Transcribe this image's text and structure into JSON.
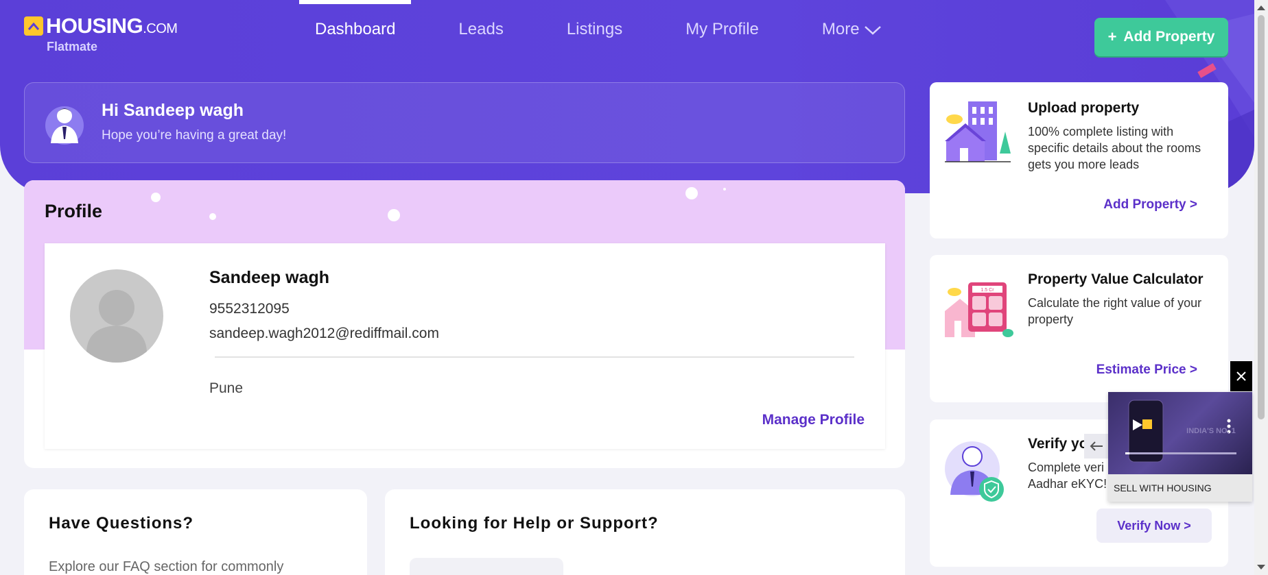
{
  "brand": {
    "name": "HOUSING",
    "suffix": ".COM",
    "sub": "Flatmate"
  },
  "nav": {
    "items": [
      {
        "label": "Dashboard"
      },
      {
        "label": "Leads"
      },
      {
        "label": "Listings"
      },
      {
        "label": "My Profile"
      },
      {
        "label": "More"
      }
    ],
    "add_button": "Add Property"
  },
  "greeting": {
    "title": "Hi Sandeep wagh",
    "subtitle": "Hope you’re having a great day!"
  },
  "profile": {
    "title": "Profile",
    "name": "Sandeep wagh",
    "phone": "9552312095",
    "email": "sandeep.wagh2012@rediffmail.com",
    "city": "Pune",
    "manage": "Manage Profile"
  },
  "questions": {
    "title": "Have Questions?",
    "text": "Explore our FAQ section for commonly"
  },
  "support": {
    "title": "Looking for Help or Support?"
  },
  "side": {
    "upload": {
      "title": "Upload property",
      "desc": "100% complete listing with specific details about the rooms gets you more leads",
      "link": "Add Property"
    },
    "calculator": {
      "title": "Property Value Calculator",
      "desc": "Calculate the right value of your property",
      "link": "Estimate Price",
      "screen": "1.5 Cr"
    },
    "verify": {
      "title": "Verify yo",
      "desc": "Complete veri Aadhar eKYC!",
      "button": "Verify Now >"
    }
  },
  "video": {
    "label": "SELL WITH HOUSING",
    "overlay": "INDIA'S NO. 1"
  },
  "colors": {
    "primary": "#5b3fd8",
    "accent": "#3ec99a",
    "link": "#5b30c9",
    "band": "#ebcafa"
  }
}
